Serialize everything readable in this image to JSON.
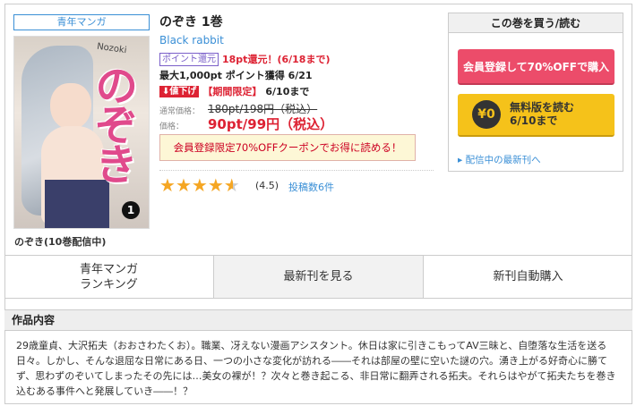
{
  "genre_tag": "青年マンガ",
  "cover": {
    "title_art": "のぞき",
    "sub_art": "Nozoki",
    "volume_badge": "1"
  },
  "series_name": "のぞき(10巻配信中)",
  "title": "のぞき 1巻",
  "author": "Black rabbit",
  "point_badge": "ポイント還元",
  "point_return": "18pt還元！(6/18まで)",
  "max_points": "最大1,000pt ポイント獲得 6/21",
  "price_down_badge": "値下げ",
  "limited_label": "【期間限定】",
  "limited_until": "6/10まで",
  "normal_price_label": "通常価格：",
  "normal_price": "180pt/198円（税込）",
  "price_label": "価格：",
  "price": "90pt/99円（税込）",
  "coupon_text": "会員登録限定70%OFFクーポンでお得に読める！",
  "rating": {
    "value": 4.5,
    "display": "(4.5)",
    "reviews_link": "投稿数6件"
  },
  "buy_panel": {
    "header": "この巻を買う/読む",
    "buy_button": "会員登録して70%OFFで購入",
    "free_circle": "¥0",
    "free_line1": "無料版を読む",
    "free_line2": "6/10まで",
    "latest_link": "配信中の最新刊へ"
  },
  "nav": {
    "ranking_line1": "青年マンガ",
    "ranking_line2": "ランキング",
    "latest": "最新刊を見る",
    "auto_purchase": "新刊自動購入"
  },
  "description": {
    "header": "作品内容",
    "text": "29歳童貞、大沢拓夫（おおさわたくお）。職業、冴えない漫画アシスタント。休日は家に引きこもってAV三昧と、自堕落な生活を送る日々。しかし、そんな退屈な日常にある日、一つの小さな変化が訪れる――それは部屋の壁に空いた謎の穴。湧き上がる好奇心に勝てず、思わずのぞいてしまったその先には…美女の裸が！？次々と巻き起こる、非日常に翻弄される拓夫。それらはやがて拓夫たちを巻き込むある事件へと発展していき――！？"
  },
  "colors": {
    "accent_blue": "#3a8fd6",
    "red": "#dd2233",
    "buy_pink": "#ec4c6a",
    "free_yellow": "#f5c21a",
    "star": "#f5a623"
  }
}
